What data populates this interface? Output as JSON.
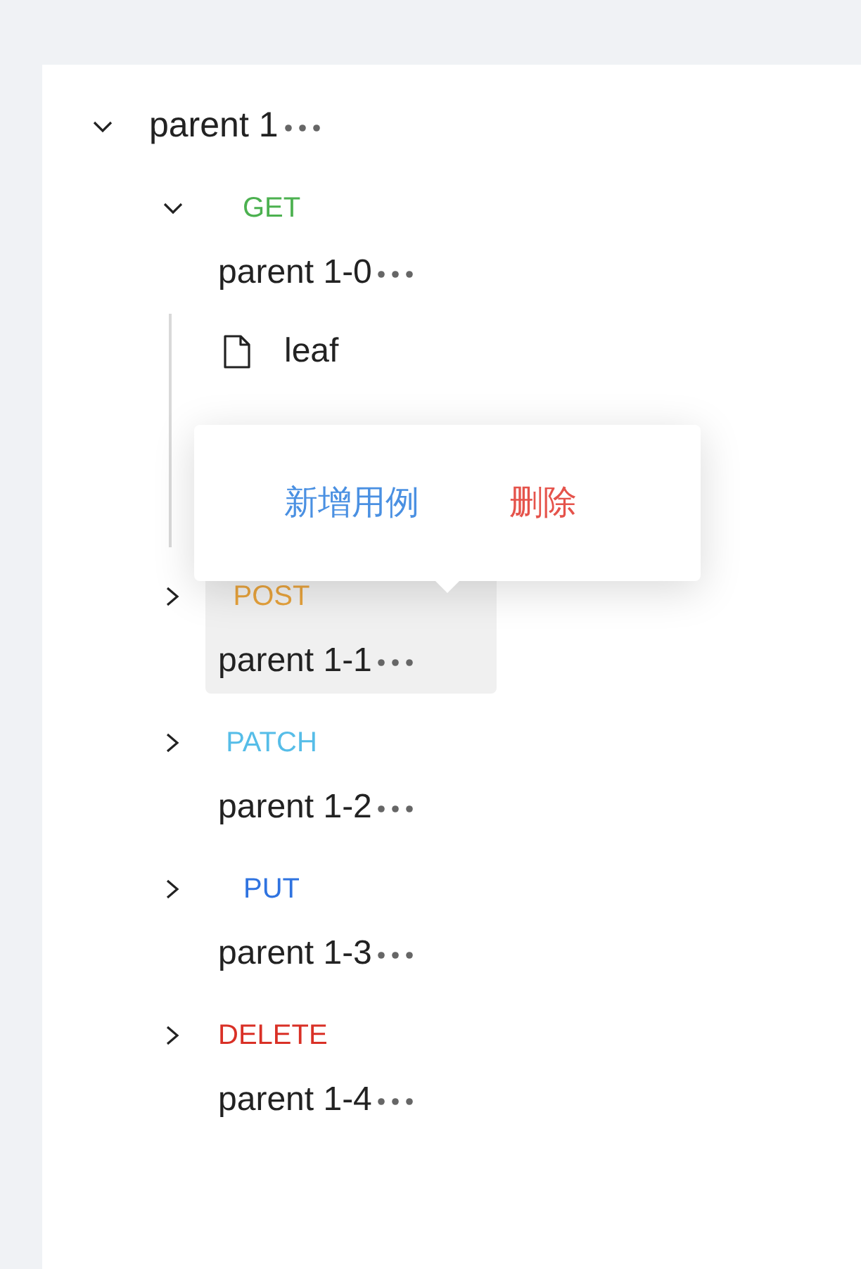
{
  "tree": [
    {
      "label": "parent 1",
      "expanded": true,
      "children": [
        {
          "method": "GET",
          "color": "#4cb150",
          "label": "parent 1-0",
          "expanded": true,
          "selected": false,
          "children": [
            {
              "label": "leaf"
            }
          ]
        },
        {
          "method": "POST",
          "color": "#e6a23c",
          "label": "parent 1-1",
          "expanded": false,
          "selected": true
        },
        {
          "method": "PATCH",
          "color": "#56bde8",
          "label": "parent 1-2",
          "expanded": false,
          "selected": false
        },
        {
          "method": "PUT",
          "color": "#2f73e0",
          "label": "parent 1-3",
          "expanded": false,
          "selected": false
        },
        {
          "method": "DELETE",
          "color": "#d93026",
          "label": "parent 1-4",
          "expanded": false,
          "selected": false
        }
      ]
    }
  ],
  "popover": {
    "actions": [
      {
        "label": "新增用例",
        "kind": "add"
      },
      {
        "label": "删除",
        "kind": "delete"
      }
    ]
  }
}
